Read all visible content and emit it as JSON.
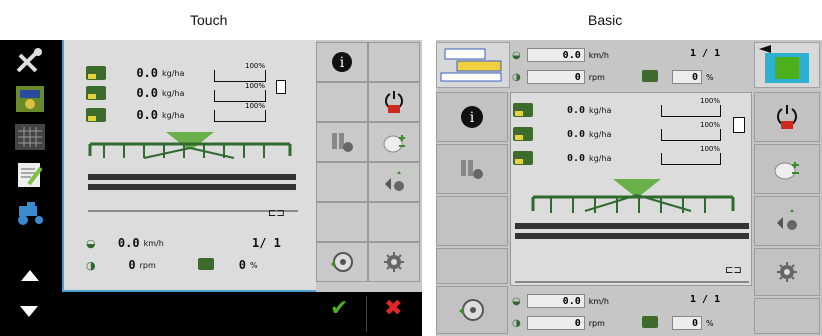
{
  "captions": {
    "touch": "Touch",
    "basic": "Basic"
  },
  "rates": [
    {
      "value": "0.0",
      "unit": "kg/ha",
      "gauge_label": "100%"
    },
    {
      "value": "0.0",
      "unit": "kg/ha",
      "gauge_label": "100%"
    },
    {
      "value": "0.0",
      "unit": "kg/ha",
      "gauge_label": "100%"
    }
  ],
  "touch": {
    "speed": {
      "value": "0.0",
      "unit": "km/h"
    },
    "section_count": "1/ 1",
    "rpm": {
      "value": "0",
      "unit": "rpm"
    },
    "percent": {
      "value": "0",
      "unit": "%"
    }
  },
  "basic": {
    "top_speed": {
      "value": "0.0",
      "unit": "km/h"
    },
    "top_rpm": {
      "value": "0",
      "unit": "rpm"
    },
    "top_section_count": "1 / 1",
    "top_percent": {
      "value": "0",
      "unit": "%"
    },
    "rates": [
      {
        "value": "0.0",
        "unit": "kg/ha",
        "gauge_label": "100%"
      },
      {
        "value": "0.0",
        "unit": "kg/ha",
        "gauge_label": "100%"
      },
      {
        "value": "0.0",
        "unit": "kg/ha",
        "gauge_label": "100%"
      }
    ],
    "bottom_speed": {
      "value": "0.0",
      "unit": "km/h"
    },
    "bottom_rpm": {
      "value": "0",
      "unit": "rpm"
    },
    "bottom_section_count": "1 / 1",
    "bottom_percent": {
      "value": "0",
      "unit": "%"
    }
  },
  "icons": {
    "info": "i",
    "confirm": "✔",
    "cancel": "✖"
  },
  "colors": {
    "accent_blue": "#4aa0d0",
    "machine_green": "#3c6b2b",
    "confirm_green": "#4caf1c",
    "cancel_red": "#e0262a",
    "off_red": "#cc2a20"
  }
}
